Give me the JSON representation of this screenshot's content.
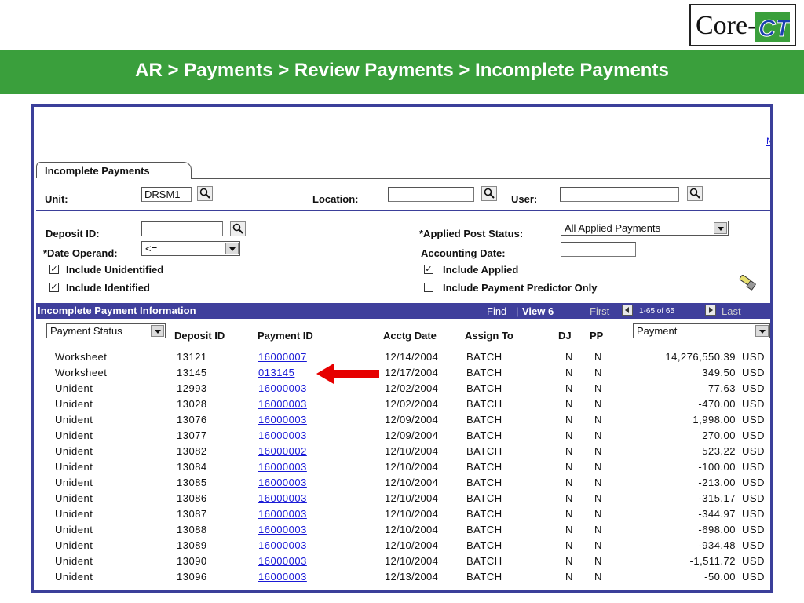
{
  "logo": {
    "text": "Core-",
    "emblem": "CT"
  },
  "header": {
    "title": "AR > Payments > Review Payments > Incomplete Payments",
    "accent": "#3a9f3c"
  },
  "app": {
    "top_link": "N",
    "tab_label": "Incomplete Payments",
    "unit": {
      "label": "Unit:",
      "value": "DRSM1"
    },
    "location": {
      "label": "Location:",
      "value": ""
    },
    "user": {
      "label": "User:",
      "value": ""
    },
    "deposit_id": {
      "label": "Deposit ID:",
      "value": ""
    },
    "date_operand": {
      "label": "*Date Operand:",
      "value": "<="
    },
    "applied_post_status": {
      "label": "*Applied Post Status:",
      "value": "All Applied Payments"
    },
    "accounting_date": {
      "label": "Accounting Date:",
      "value": ""
    },
    "checks": {
      "include_unidentified": "Include Unidentified",
      "include_identified": "Include Identified",
      "include_applied": "Include Applied",
      "include_predictor": "Include Payment Predictor Only"
    },
    "grid": {
      "title": "Incomplete Payment Information",
      "find": "Find",
      "pipe": "|",
      "view": "View 6",
      "first": "First",
      "range": "1-65 of 65",
      "last": "Last",
      "status_select": "Payment Status",
      "amount_select": "Payment",
      "headers": {
        "deposit_id": "Deposit ID",
        "payment_id": "Payment ID",
        "acctg_date": "Acctg Date",
        "assign_to": "Assign To",
        "dj": "DJ",
        "pp": "PP"
      },
      "rows": [
        {
          "status": "Worksheet",
          "deposit": "13121",
          "payment": "16000007",
          "date": "12/14/2004",
          "assign": "BATCH",
          "dj": "N",
          "pp": "N",
          "amount": "14,276,550.39",
          "currency": "USD"
        },
        {
          "status": "Worksheet",
          "deposit": "13145",
          "payment": "013145",
          "date": "12/17/2004",
          "assign": "BATCH",
          "dj": "N",
          "pp": "N",
          "amount": "349.50",
          "currency": "USD"
        },
        {
          "status": "Unident",
          "deposit": "12993",
          "payment": "16000003",
          "date": "12/02/2004",
          "assign": "BATCH",
          "dj": "N",
          "pp": "N",
          "amount": "77.63",
          "currency": "USD"
        },
        {
          "status": "Unident",
          "deposit": "13028",
          "payment": "16000003",
          "date": "12/02/2004",
          "assign": "BATCH",
          "dj": "N",
          "pp": "N",
          "amount": "-470.00",
          "currency": "USD"
        },
        {
          "status": "Unident",
          "deposit": "13076",
          "payment": "16000003",
          "date": "12/09/2004",
          "assign": "BATCH",
          "dj": "N",
          "pp": "N",
          "amount": "1,998.00",
          "currency": "USD"
        },
        {
          "status": "Unident",
          "deposit": "13077",
          "payment": "16000003",
          "date": "12/09/2004",
          "assign": "BATCH",
          "dj": "N",
          "pp": "N",
          "amount": "270.00",
          "currency": "USD"
        },
        {
          "status": "Unident",
          "deposit": "13082",
          "payment": "16000002",
          "date": "12/10/2004",
          "assign": "BATCH",
          "dj": "N",
          "pp": "N",
          "amount": "523.22",
          "currency": "USD"
        },
        {
          "status": "Unident",
          "deposit": "13084",
          "payment": "16000003",
          "date": "12/10/2004",
          "assign": "BATCH",
          "dj": "N",
          "pp": "N",
          "amount": "-100.00",
          "currency": "USD"
        },
        {
          "status": "Unident",
          "deposit": "13085",
          "payment": "16000003",
          "date": "12/10/2004",
          "assign": "BATCH",
          "dj": "N",
          "pp": "N",
          "amount": "-213.00",
          "currency": "USD"
        },
        {
          "status": "Unident",
          "deposit": "13086",
          "payment": "16000003",
          "date": "12/10/2004",
          "assign": "BATCH",
          "dj": "N",
          "pp": "N",
          "amount": "-315.17",
          "currency": "USD"
        },
        {
          "status": "Unident",
          "deposit": "13087",
          "payment": "16000003",
          "date": "12/10/2004",
          "assign": "BATCH",
          "dj": "N",
          "pp": "N",
          "amount": "-344.97",
          "currency": "USD"
        },
        {
          "status": "Unident",
          "deposit": "13088",
          "payment": "16000003",
          "date": "12/10/2004",
          "assign": "BATCH",
          "dj": "N",
          "pp": "N",
          "amount": "-698.00",
          "currency": "USD"
        },
        {
          "status": "Unident",
          "deposit": "13089",
          "payment": "16000003",
          "date": "12/10/2004",
          "assign": "BATCH",
          "dj": "N",
          "pp": "N",
          "amount": "-934.48",
          "currency": "USD"
        },
        {
          "status": "Unident",
          "deposit": "13090",
          "payment": "16000003",
          "date": "12/10/2004",
          "assign": "BATCH",
          "dj": "N",
          "pp": "N",
          "amount": "-1,511.72",
          "currency": "USD"
        },
        {
          "status": "Unident",
          "deposit": "13096",
          "payment": "16000003",
          "date": "12/13/2004",
          "assign": "BATCH",
          "dj": "N",
          "pp": "N",
          "amount": "-50.00",
          "currency": "USD"
        }
      ]
    }
  }
}
